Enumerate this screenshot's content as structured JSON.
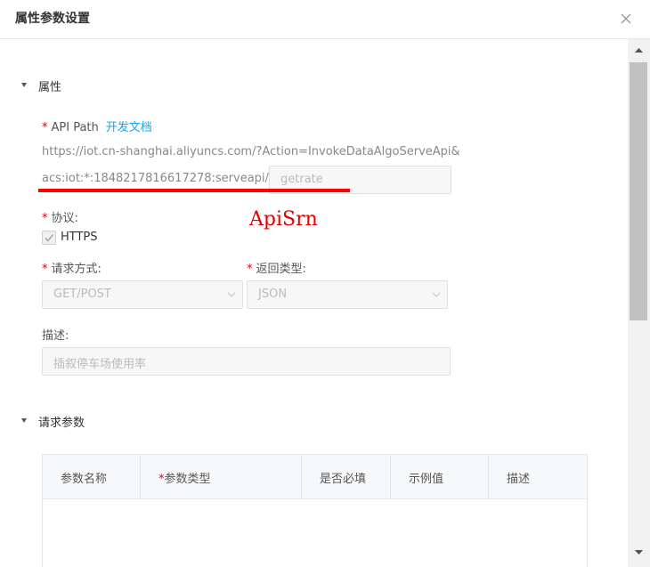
{
  "dialog": {
    "title": "属性参数设置",
    "close_icon": "close-icon"
  },
  "attributes": {
    "section_label": "属性",
    "api_path": {
      "required_mark": "*",
      "label": "API Path",
      "doc_link": "开发文档",
      "url_line1": "https://iot.cn-shanghai.aliyuncs.com/?Action=InvokeDataAlgoServeApi&",
      "url_prefix": "acs:iot:*:1848217816617278:serveapi/",
      "suffix_placeholder": "getrate"
    },
    "annotation": "ApiSrn",
    "protocol": {
      "required_mark": "*",
      "label": "协议:",
      "option": "HTTPS",
      "checked": true
    },
    "request_method": {
      "required_mark": "*",
      "label": "请求方式:",
      "value": "GET/POST"
    },
    "response_type": {
      "required_mark": "*",
      "label": "返回类型:",
      "value": "JSON"
    },
    "description": {
      "label": "描述:",
      "placeholder": "插叙停车场使用率"
    }
  },
  "request_params": {
    "section_label": "请求参数",
    "columns": [
      {
        "label": "参数名称",
        "required": false
      },
      {
        "label": "参数类型",
        "required": true
      },
      {
        "label": "是否必填",
        "required": false
      },
      {
        "label": "示例值",
        "required": false
      },
      {
        "label": "描述",
        "required": false
      }
    ],
    "required_mark": "*"
  },
  "colors": {
    "accent_link": "#1aa6e8",
    "required": "#d9001b",
    "annotation": "#e00000"
  }
}
